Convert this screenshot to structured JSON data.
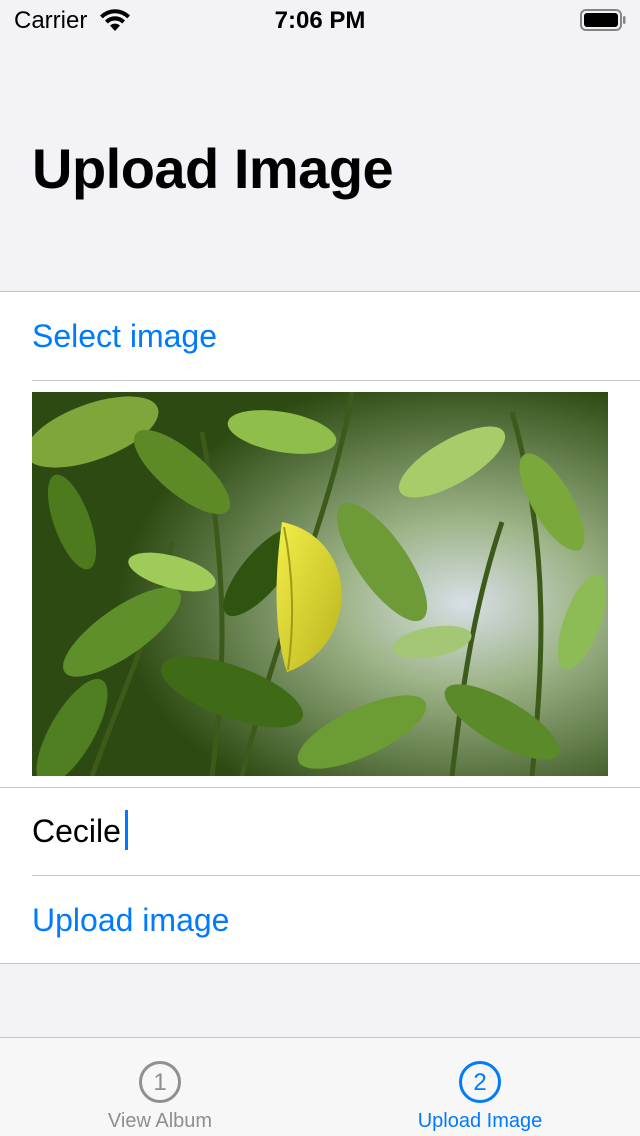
{
  "status_bar": {
    "carrier": "Carrier",
    "time": "7:06 PM",
    "wifi_icon": "wifi-icon",
    "battery_icon": "battery-icon"
  },
  "page": {
    "title": "Upload Image"
  },
  "form": {
    "select_image_label": "Select image",
    "photo_icon": "leaf-photo",
    "name_value": "Cecile",
    "upload_label": "Upload image"
  },
  "tab_bar": {
    "tabs": [
      {
        "number": "1",
        "label": "View Album",
        "selected": false
      },
      {
        "number": "2",
        "label": "Upload Image",
        "selected": true
      }
    ]
  },
  "colors": {
    "accent": "#007aff",
    "background": "#f2f2f7",
    "inactive": "#8e8e93"
  }
}
